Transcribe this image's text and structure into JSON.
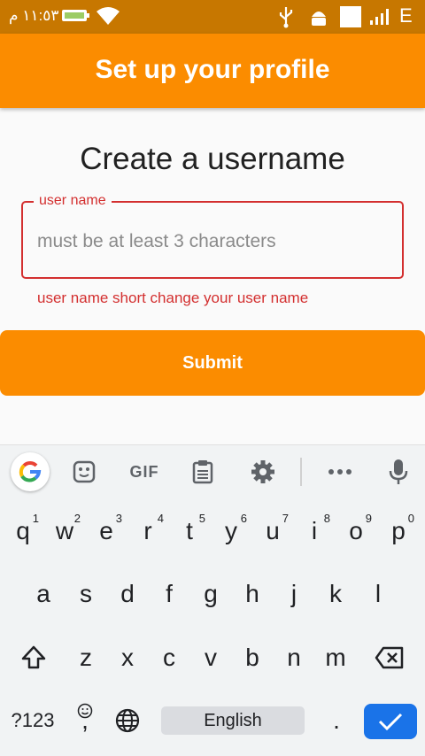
{
  "status_bar": {
    "time": "١١:٥٣ م",
    "network_type": "E"
  },
  "app_bar": {
    "title": "Set up your profile"
  },
  "heading": "Create a username",
  "username_field": {
    "label": "user name",
    "placeholder": "must be at least 3 characters",
    "value": "",
    "error": "user name short change your user name"
  },
  "submit_label": "Submit",
  "colors": {
    "status_bar": "#c77700",
    "app_bar": "#fb8c00",
    "error": "#d32f2f",
    "keyboard_accent": "#1a73e8"
  },
  "keyboard": {
    "toolbar": [
      "google-icon",
      "sticker-icon",
      "gif",
      "clipboard-icon",
      "settings-icon",
      "more-icon",
      "mic-icon"
    ],
    "gif_label": "GIF",
    "row1": [
      {
        "key": "q",
        "hint": "1"
      },
      {
        "key": "w",
        "hint": "2"
      },
      {
        "key": "e",
        "hint": "3"
      },
      {
        "key": "r",
        "hint": "4"
      },
      {
        "key": "t",
        "hint": "5"
      },
      {
        "key": "y",
        "hint": "6"
      },
      {
        "key": "u",
        "hint": "7"
      },
      {
        "key": "i",
        "hint": "8"
      },
      {
        "key": "o",
        "hint": "9"
      },
      {
        "key": "p",
        "hint": "0"
      }
    ],
    "row2": [
      "a",
      "s",
      "d",
      "f",
      "g",
      "h",
      "j",
      "k",
      "l"
    ],
    "row3": [
      "z",
      "x",
      "c",
      "v",
      "b",
      "n",
      "m"
    ],
    "symbols_label": "?123",
    "comma": ",",
    "space_label": "English",
    "period": "."
  }
}
